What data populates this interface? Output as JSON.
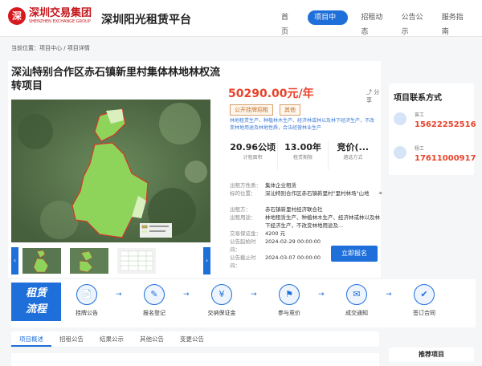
{
  "header": {
    "logo_mark": "深",
    "logo_cn": "深圳交易集团",
    "logo_en": "SHENZHEN EXCHANGE GROUP",
    "platform": "深圳阳光租赁平台",
    "nav": [
      "首页",
      "项目中心",
      "招租动态",
      "公告公示",
      "服务指南"
    ],
    "active_nav": 1
  },
  "breadcrumb": "当前位置：项目中心 / 项目详情",
  "project": {
    "title": "深汕特别合作区赤石镇新里村集体林地林权流转项目",
    "price": "50290.00元/年",
    "share": "分享",
    "tags": [
      "公开挂牌招租",
      "其他"
    ],
    "usage": "林地租赁生产、种植林木生产、经济林或林以及林下经济生产，不改变林地用途及林地性质，合法经营林业生产",
    "stats": [
      {
        "value": "20.96公顷",
        "label": "计租面积"
      },
      {
        "value": "13.00年",
        "label": "租赁期限"
      },
      {
        "value": "竞价(...",
        "label": "遴选方式"
      }
    ],
    "details": [
      {
        "label": "出租方性质：",
        "value": "集体企业租赁"
      },
      {
        "label": "标的位置：",
        "value": "深汕特别合作区赤石镇新里村\"里村林场\"山地"
      },
      {
        "label": "出租方：",
        "value": "赤石镇新里村经济联合社"
      },
      {
        "label": "出租用途：",
        "value": "林地租赁生产、种植林木生产、经济林或林以及林下经济生产，不改变林地用途及..."
      },
      {
        "label": "交易保证金：",
        "value": "4200 元"
      },
      {
        "label": "公告起始时间：",
        "value": "2024-02-29 00:00:00"
      },
      {
        "label": "公告截止时间：",
        "value": "2024-03-07 00:00:00"
      }
    ],
    "apply_button": "立即报名",
    "thumb_prev": "‹",
    "thumb_next": "›"
  },
  "contact": {
    "title": "项目联系方式",
    "persons": [
      {
        "name": "曾工",
        "phone": "15622252516"
      },
      {
        "name": "杨工",
        "phone": "17611000917"
      }
    ]
  },
  "flow": {
    "title_line1": "租赁",
    "title_line2": "流程",
    "steps": [
      {
        "label": "挂牌公告",
        "icon": "📄"
      },
      {
        "label": "报名登记",
        "icon": "✎"
      },
      {
        "label": "交纳保证金",
        "icon": "¥"
      },
      {
        "label": "参与竞价",
        "icon": "⚑"
      },
      {
        "label": "成交通知",
        "icon": "✉"
      },
      {
        "label": "签订合同",
        "icon": "✔"
      }
    ]
  },
  "tabs": [
    "项目概述",
    "招租公告",
    "结果公示",
    "其他公告",
    "变更公告"
  ],
  "active_tab": 0,
  "recommend_title": "推荐项目"
}
